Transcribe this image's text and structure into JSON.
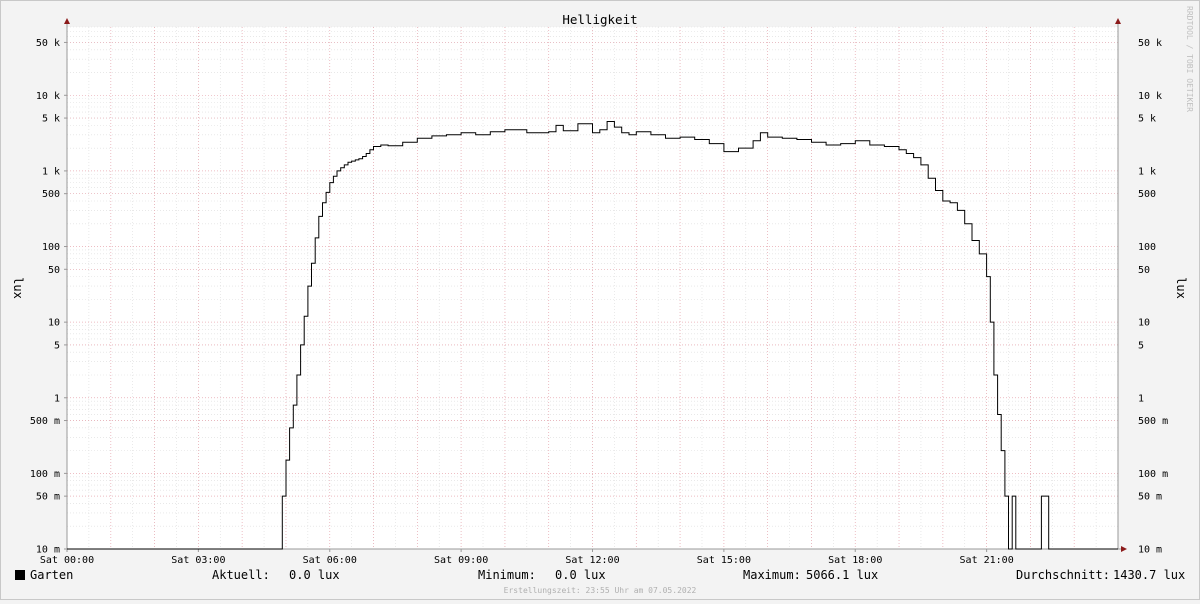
{
  "chart_data": {
    "type": "line",
    "title": "Helligkeit",
    "ylabel": "lux",
    "y_scale": "log",
    "ylim": [
      0.01,
      80000
    ],
    "xlim": [
      "Sat 00:00",
      "Sun 00:00"
    ],
    "x_tick_labels": [
      "Sat 00:00",
      "Sat 03:00",
      "Sat 06:00",
      "Sat 09:00",
      "Sat 12:00",
      "Sat 15:00",
      "Sat 18:00",
      "Sat 21:00"
    ],
    "y_ticks": [
      {
        "value": 50000,
        "label": "50 k"
      },
      {
        "value": 10000,
        "label": "10 k"
      },
      {
        "value": 5000,
        "label": "5 k"
      },
      {
        "value": 1000,
        "label": "1 k"
      },
      {
        "value": 500,
        "label": "500"
      },
      {
        "value": 100,
        "label": "100"
      },
      {
        "value": 50,
        "label": "50"
      },
      {
        "value": 10,
        "label": "10"
      },
      {
        "value": 5,
        "label": "5"
      },
      {
        "value": 1,
        "label": "1"
      },
      {
        "value": 0.5,
        "label": "500 m"
      },
      {
        "value": 0.1,
        "label": "100 m"
      },
      {
        "value": 0.05,
        "label": "50 m"
      },
      {
        "value": 0.01,
        "label": "10 m"
      }
    ],
    "grid": true,
    "series": [
      {
        "name": "Garten",
        "color": "#000000",
        "x": [
          "00:00",
          "04:55",
          "05:00",
          "05:05",
          "05:10",
          "05:15",
          "05:20",
          "05:25",
          "05:30",
          "05:35",
          "05:40",
          "05:45",
          "05:50",
          "05:55",
          "06:00",
          "06:05",
          "06:10",
          "06:15",
          "06:20",
          "06:25",
          "06:30",
          "06:35",
          "06:40",
          "06:45",
          "06:50",
          "06:55",
          "07:00",
          "07:10",
          "07:20",
          "07:40",
          "08:00",
          "08:20",
          "08:40",
          "09:00",
          "09:20",
          "09:40",
          "10:00",
          "10:30",
          "11:00",
          "11:10",
          "11:20",
          "11:40",
          "12:00",
          "12:10",
          "12:20",
          "12:30",
          "12:40",
          "12:50",
          "13:00",
          "13:20",
          "13:40",
          "14:00",
          "14:20",
          "14:40",
          "15:00",
          "15:20",
          "15:40",
          "15:50",
          "16:00",
          "16:20",
          "16:40",
          "17:00",
          "17:20",
          "17:40",
          "18:00",
          "18:20",
          "18:40",
          "19:00",
          "19:10",
          "19:20",
          "19:30",
          "19:40",
          "19:50",
          "20:00",
          "20:10",
          "20:20",
          "20:30",
          "20:40",
          "20:50",
          "21:00",
          "21:05",
          "21:10",
          "21:15",
          "21:20",
          "21:25",
          "21:30",
          "21:35",
          "21:40",
          "21:45",
          "21:50",
          "21:55",
          "22:00",
          "22:05",
          "22:15",
          "22:25",
          "22:35",
          "22:45",
          "23:00",
          "23:30"
        ],
        "y": [
          0.01,
          0.05,
          0.15,
          0.4,
          0.8,
          2,
          5,
          12,
          30,
          60,
          130,
          250,
          380,
          520,
          700,
          850,
          1000,
          1100,
          1200,
          1300,
          1350,
          1400,
          1450,
          1550,
          1700,
          1900,
          2100,
          2200,
          2150,
          2400,
          2700,
          2900,
          3000,
          3200,
          3000,
          3300,
          3500,
          3200,
          3300,
          4000,
          3400,
          4200,
          3200,
          3500,
          4500,
          3800,
          3200,
          3000,
          3300,
          3000,
          2700,
          2800,
          2600,
          2300,
          1800,
          2000,
          2500,
          3200,
          2800,
          2700,
          2600,
          2400,
          2200,
          2300,
          2500,
          2200,
          2100,
          1900,
          1700,
          1500,
          1200,
          800,
          550,
          400,
          380,
          300,
          200,
          120,
          80,
          40,
          10,
          2,
          0.6,
          0.2,
          0.05,
          0.01,
          0.05,
          0.01,
          0.01,
          0.01,
          0.01,
          0.01,
          0.01,
          0.05,
          0.01,
          0.01,
          0.01,
          0.01,
          0.01
        ]
      }
    ],
    "legend": {
      "placement": "bottom",
      "series_label": "Garten",
      "current_label": "Aktuell:",
      "current_value": "0.0 lux",
      "min_label": "Minimum:",
      "min_value": "0.0 lux",
      "max_label": "Maximum:",
      "max_value": "5066.1 lux",
      "avg_label": "Durchschnitt:",
      "avg_value": "1430.7 lux"
    },
    "footer": "Erstellungszeit: 23:55 Uhr am 07.05.2022",
    "watermark": "RRDTOOL / TOBI OETIKER"
  }
}
